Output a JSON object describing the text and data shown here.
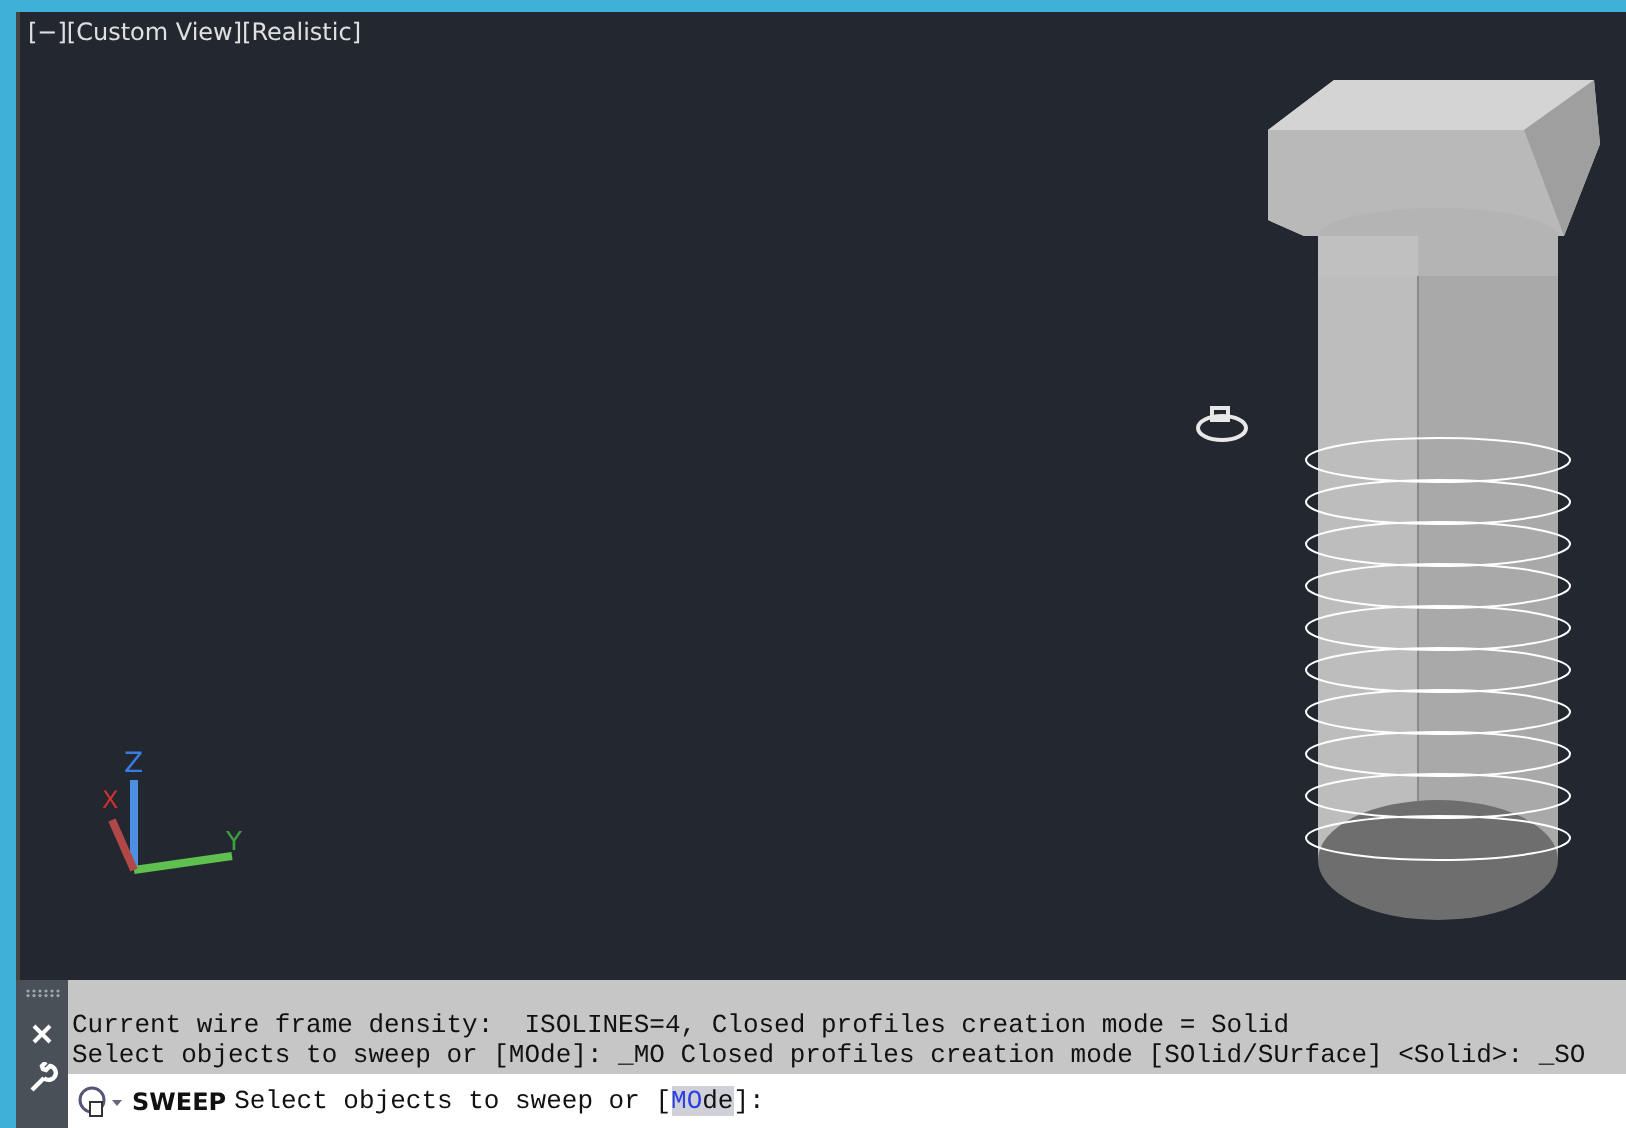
{
  "viewport": {
    "label": "[−][Custom View][Realistic]",
    "axes": {
      "x": "X",
      "y": "Y",
      "z": "Z"
    }
  },
  "command_history": [
    "Current wire frame density:  ISOLINES=4, Closed profiles creation mode = Solid",
    "Select objects to sweep or [MOde]: _MO Closed profiles creation mode [SOlid/SUrface] <Solid>: _SO"
  ],
  "command_line": {
    "command": "SWEEP",
    "prompt": "Select objects to sweep or [",
    "option": {
      "key": "MO",
      "rest": "de"
    },
    "suffix": "]:"
  }
}
